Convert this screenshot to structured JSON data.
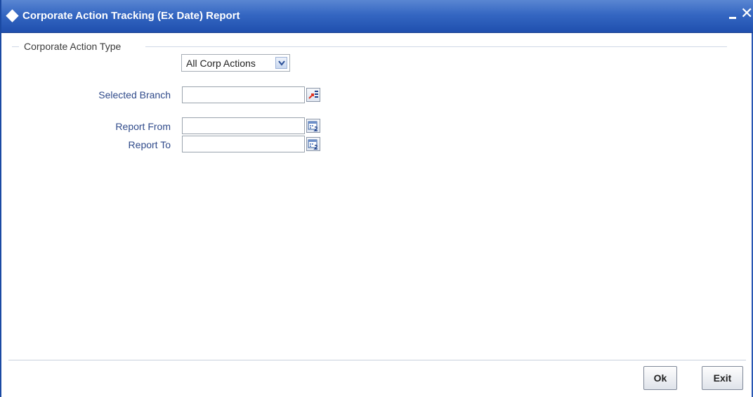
{
  "window": {
    "title": "Corporate Action Tracking (Ex Date) Report",
    "minimize_glyph": "",
    "close_glyph": "✕"
  },
  "form": {
    "section_legend": "Corporate Action Type",
    "corp_action_type": {
      "selected": "All Corp Actions",
      "options": [
        "All Corp Actions"
      ]
    },
    "selected_branch": {
      "label": "Selected Branch",
      "value": ""
    },
    "report_from": {
      "label": "Report From",
      "value": ""
    },
    "report_to": {
      "label": "Report To",
      "value": ""
    }
  },
  "footer": {
    "ok_label": "Ok",
    "exit_label": "Exit"
  },
  "icons": {
    "title": "diamond-icon",
    "branch_lookup": "list-lookup-icon",
    "date_picker": "calendar-icon",
    "dropdown": "chevron-down-icon"
  },
  "colors": {
    "titlebar": "#3567c2",
    "label": "#2f4a8a",
    "lookup_accent": "#e0301e"
  }
}
